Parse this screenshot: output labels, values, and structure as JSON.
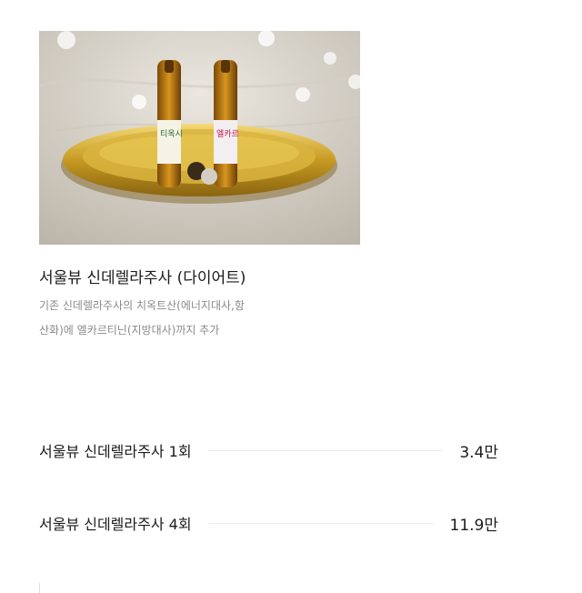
{
  "product": {
    "image_alt": "서울뷰 신데렐라주사 앰플",
    "ampoule_labels": [
      "티옥시",
      "엘카르"
    ],
    "title": "서울뷰 신데렐라주사 (다이어트)",
    "description_line1": "기존 신데렐라주사의 치옥트산(에너지대사,항",
    "description_line2": "산화)에 엘카르티닌(지방대사)까지 추가"
  },
  "prices": [
    {
      "name": "서울뷰 신데렐라주사 1회",
      "amount": "3.4만"
    },
    {
      "name": "서울뷰 신데렐라주사 4회",
      "amount": "11.9만"
    }
  ]
}
